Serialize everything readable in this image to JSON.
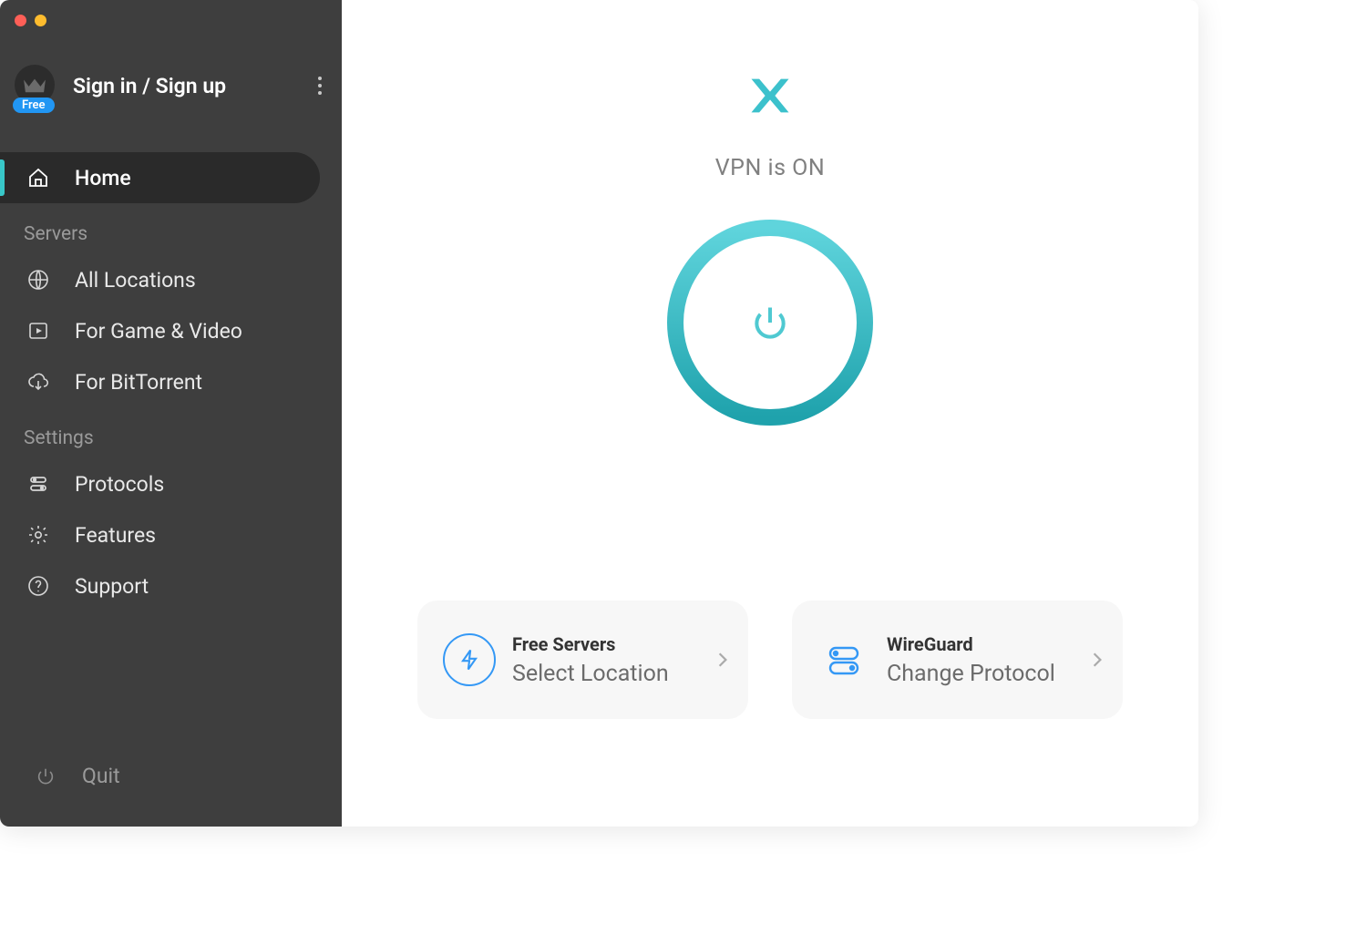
{
  "window": {
    "close": "close",
    "minimize": "minimize"
  },
  "account": {
    "sign_in_label": "Sign in / Sign up",
    "badge": "Free"
  },
  "nav": {
    "home": "Home",
    "servers_heading": "Servers",
    "all_locations": "All Locations",
    "game_video": "For Game & Video",
    "bittorrent": "For BitTorrent",
    "settings_heading": "Settings",
    "protocols": "Protocols",
    "features": "Features",
    "support": "Support",
    "quit": "Quit"
  },
  "main": {
    "status": "VPN is ON",
    "cards": {
      "location": {
        "title": "Free Servers",
        "subtitle": "Select Location"
      },
      "protocol": {
        "title": "WireGuard",
        "subtitle": "Change Protocol"
      }
    }
  },
  "colors": {
    "accent": "#38c7c8",
    "accent_dark": "#2aa0a5",
    "blue": "#2196f3"
  }
}
